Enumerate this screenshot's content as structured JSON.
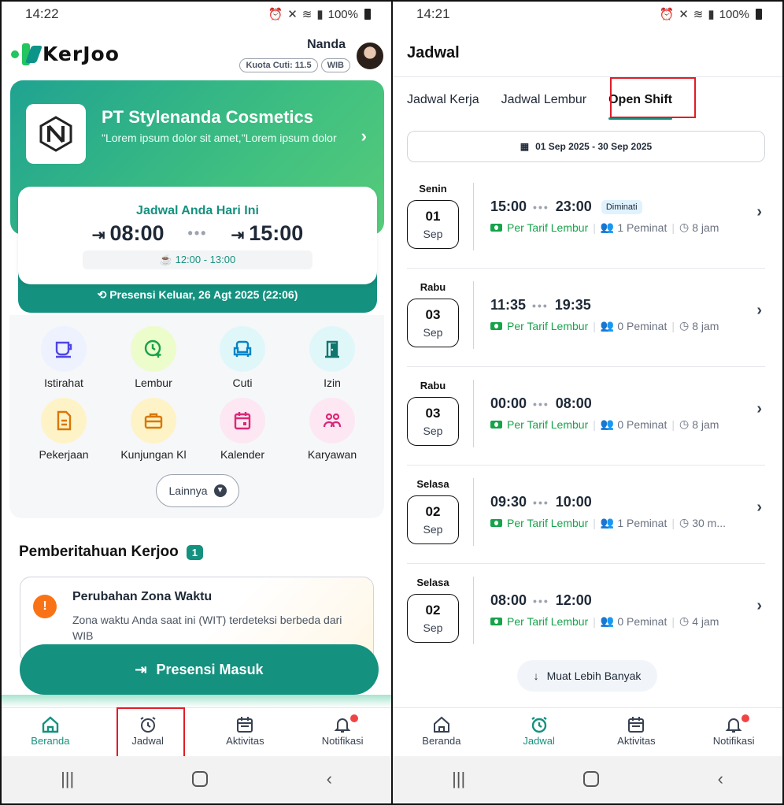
{
  "left_screen": {
    "status": {
      "time": "14:22",
      "battery": "100%"
    },
    "brand": {
      "name": "KerJoo"
    },
    "user": {
      "name": "Nanda",
      "leave_quota": "Kuota Cuti: 11.5",
      "timezone": "WIB"
    },
    "company": {
      "name": "PT Stylenanda Cosmetics",
      "description": "\"Lorem ipsum dolor sit amet,\"Lorem ipsum dolor"
    },
    "today_schedule": {
      "title": "Jadwal Anda Hari Ini",
      "start": "08:00",
      "end": "15:00",
      "break": "12:00 - 13:00"
    },
    "last_attendance": "Presensi Keluar, 26 Agt 2025 (22:06)",
    "menu": [
      {
        "label": "Istirahat",
        "icon": "cup-icon"
      },
      {
        "label": "Lembur",
        "icon": "clock-plus-icon"
      },
      {
        "label": "Cuti",
        "icon": "armchair-icon"
      },
      {
        "label": "Izin",
        "icon": "door-icon"
      },
      {
        "label": "Pekerjaan",
        "icon": "document-icon"
      },
      {
        "label": "Kunjungan Kl",
        "icon": "briefcase-icon"
      },
      {
        "label": "Kalender",
        "icon": "calendar-icon"
      },
      {
        "label": "Karyawan",
        "icon": "people-icon"
      }
    ],
    "more_label": "Lainnya",
    "notifications": {
      "title": "Pemberitahuan Kerjoo",
      "count": "1",
      "item": {
        "title": "Perubahan Zona Waktu",
        "body": "Zona waktu Anda saat ini (WIT) terdeteksi berbeda dari WIB"
      }
    },
    "checkin_label": "Presensi Masuk",
    "nav": [
      {
        "label": "Beranda",
        "icon": "home-icon"
      },
      {
        "label": "Jadwal",
        "icon": "alarm-clock-icon"
      },
      {
        "label": "Aktivitas",
        "icon": "calendar-icon"
      },
      {
        "label": "Notifikasi",
        "icon": "bell-icon"
      }
    ]
  },
  "right_screen": {
    "status": {
      "time": "14:21",
      "battery": "100%"
    },
    "title": "Jadwal",
    "tabs": [
      "Jadwal Kerja",
      "Jadwal Lembur",
      "Open Shift"
    ],
    "date_range": "01 Sep 2025 - 30 Sep 2025",
    "shifts": [
      {
        "day": "Senin",
        "date": "01",
        "month": "Sep",
        "start": "15:00",
        "end": "23:00",
        "tag": "Diminati",
        "rate": "Per Tarif Lembur",
        "interested": "1 Peminat",
        "duration": "8 jam"
      },
      {
        "day": "Rabu",
        "date": "03",
        "month": "Sep",
        "start": "11:35",
        "end": "19:35",
        "tag": "",
        "rate": "Per Tarif Lembur",
        "interested": "0 Peminat",
        "duration": "8 jam"
      },
      {
        "day": "Rabu",
        "date": "03",
        "month": "Sep",
        "start": "00:00",
        "end": "08:00",
        "tag": "",
        "rate": "Per Tarif Lembur",
        "interested": "0 Peminat",
        "duration": "8 jam"
      },
      {
        "day": "Selasa",
        "date": "02",
        "month": "Sep",
        "start": "09:30",
        "end": "10:00",
        "tag": "",
        "rate": "Per Tarif Lembur",
        "interested": "1 Peminat",
        "duration": "30 m..."
      },
      {
        "day": "Selasa",
        "date": "02",
        "month": "Sep",
        "start": "08:00",
        "end": "12:00",
        "tag": "",
        "rate": "Per Tarif Lembur",
        "interested": "0 Peminat",
        "duration": "4 jam"
      }
    ],
    "load_more_label": "Muat Lebih Banyak",
    "nav": [
      {
        "label": "Beranda",
        "icon": "home-icon"
      },
      {
        "label": "Jadwal",
        "icon": "alarm-clock-icon"
      },
      {
        "label": "Aktivitas",
        "icon": "calendar-icon"
      },
      {
        "label": "Notifikasi",
        "icon": "bell-icon"
      }
    ]
  },
  "colors": {
    "primary": "#14917f",
    "accent_green": "#16a34a",
    "highlight": "#e11d26"
  }
}
